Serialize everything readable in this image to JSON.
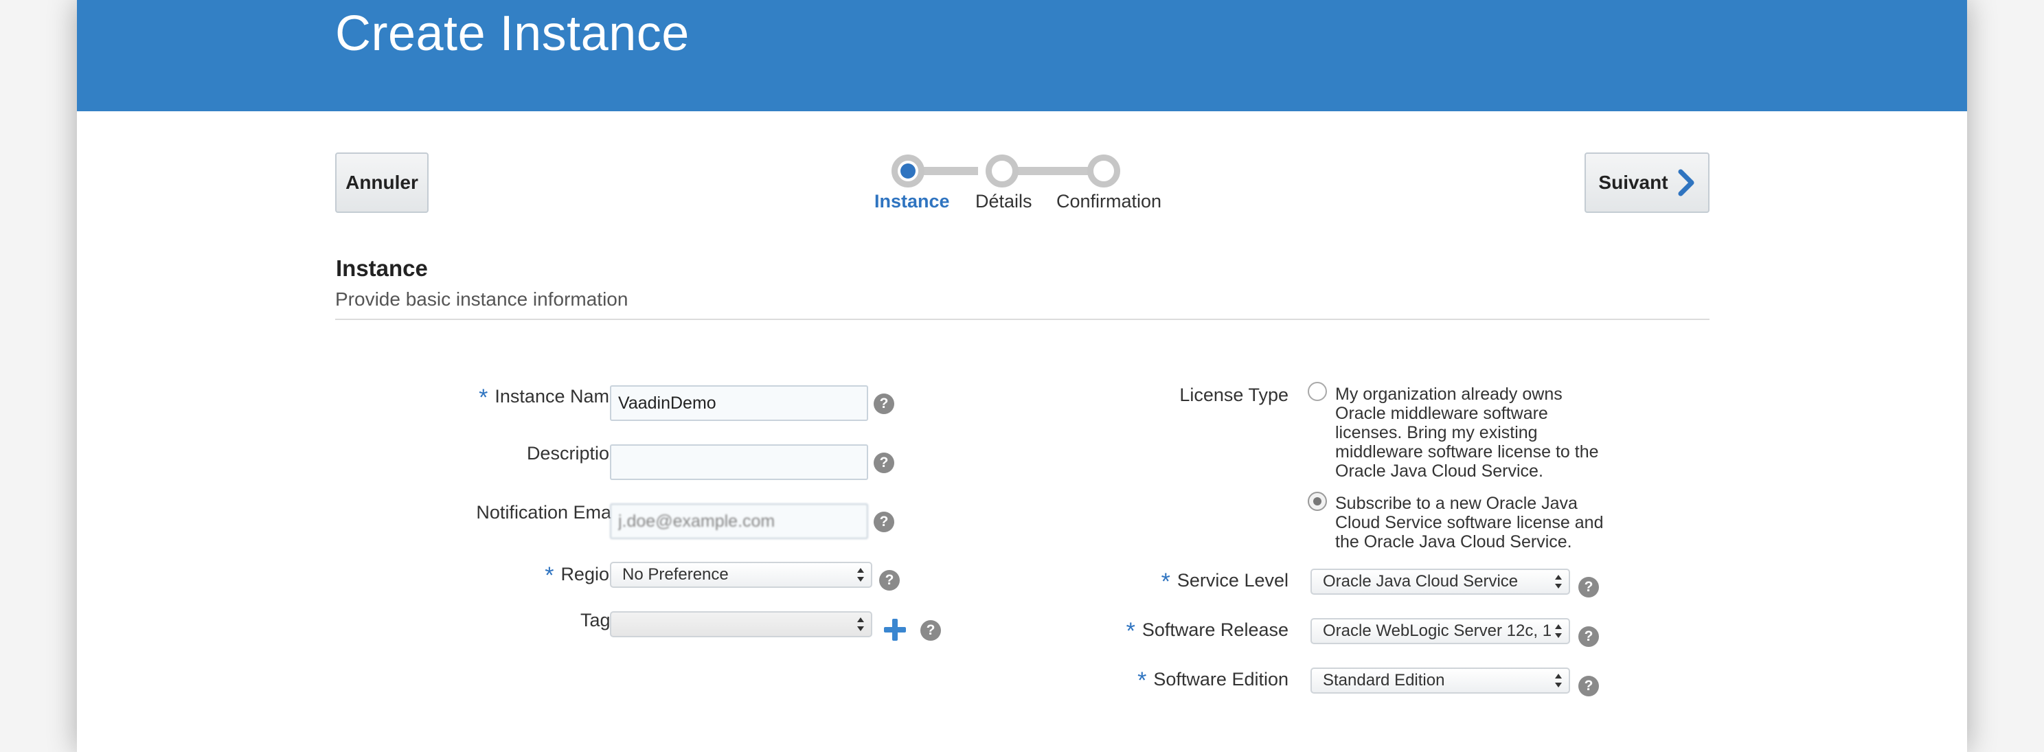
{
  "header": {
    "title": "Create Instance"
  },
  "toolbar": {
    "cancel_label": "Annuler",
    "next_label": "Suivant"
  },
  "train": {
    "steps": [
      {
        "label": "Instance",
        "state": "active"
      },
      {
        "label": "Détails",
        "state": "upcoming"
      },
      {
        "label": "Confirmation",
        "state": "upcoming"
      }
    ]
  },
  "section": {
    "title": "Instance",
    "subtitle": "Provide basic instance information"
  },
  "form": {
    "instance_name": {
      "label": "Instance Name",
      "required": true,
      "value": "VaadinDemo"
    },
    "description": {
      "label": "Description",
      "value": ""
    },
    "notification_email": {
      "label": "Notification Email",
      "value": "j.doe@example.com"
    },
    "region": {
      "label": "Region",
      "required": true,
      "selected": "No Preference"
    },
    "tags": {
      "label": "Tags",
      "selected": ""
    },
    "license_type": {
      "label": "License Type",
      "options": [
        {
          "lines": [
            "My organization already owns",
            "Oracle middleware software",
            "licenses. Bring my existing",
            "middleware software license to the",
            "Oracle Java Cloud Service."
          ],
          "checked": false
        },
        {
          "lines": [
            "Subscribe to a new Oracle Java",
            "Cloud Service software license and",
            "the Oracle Java Cloud Service."
          ],
          "checked": true
        }
      ]
    },
    "service_level": {
      "label": "Service Level",
      "required": true,
      "selected": "Oracle Java Cloud Service"
    },
    "software_release": {
      "label": "Software Release",
      "required": true,
      "selected": "Oracle WebLogic Server 12c, 1"
    },
    "software_edition": {
      "label": "Software Edition",
      "required": true,
      "selected": "Standard Edition"
    }
  },
  "icons": {
    "help": "help-icon",
    "add": "plus-icon",
    "next": "chevron-right-icon",
    "arrows": "select-arrows-icon"
  },
  "colors": {
    "header": "#3380c5",
    "accent": "#2f74c0"
  }
}
